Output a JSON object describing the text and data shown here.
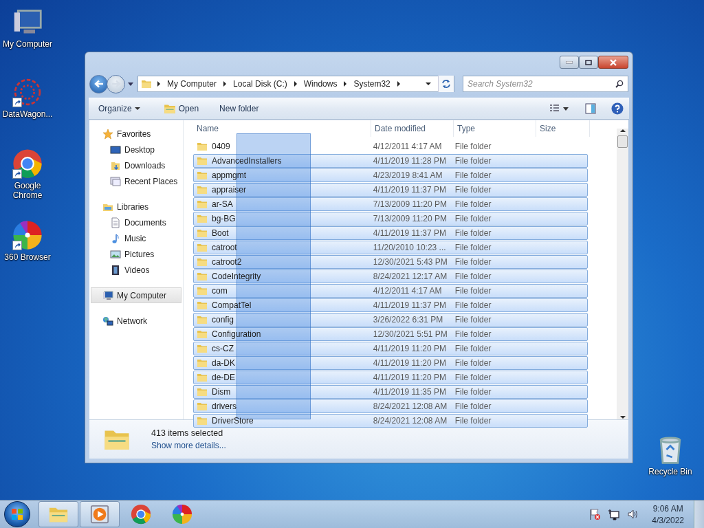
{
  "desktop_icons": [
    {
      "label": "My Computer",
      "kind": "computer"
    },
    {
      "label": "DataWagon...",
      "kind": "web"
    },
    {
      "label": "Google Chrome",
      "kind": "chrome"
    },
    {
      "label": "360 Browser",
      "kind": "pinwheel"
    },
    {
      "label": "Recycle Bin",
      "kind": "bin"
    }
  ],
  "window": {
    "address": {
      "crumbs": [
        "My Computer",
        "Local Disk (C:)",
        "Windows",
        "System32"
      ]
    },
    "search": {
      "placeholder": "Search System32"
    },
    "toolbar": {
      "organize": "Organize",
      "open": "Open",
      "new_folder": "New folder"
    },
    "nav": [
      {
        "label": "Favorites",
        "kind": "star",
        "selected": false,
        "children": [
          {
            "label": "Desktop",
            "kind": "desktop",
            "selected": false
          },
          {
            "label": "Downloads",
            "kind": "downloads",
            "selected": false
          },
          {
            "label": "Recent Places",
            "kind": "recent",
            "selected": false
          }
        ]
      },
      {
        "label": "Libraries",
        "kind": "library",
        "selected": false,
        "children": [
          {
            "label": "Documents",
            "kind": "document",
            "selected": false
          },
          {
            "label": "Music",
            "kind": "music",
            "selected": false
          },
          {
            "label": "Pictures",
            "kind": "picture",
            "selected": false
          },
          {
            "label": "Videos",
            "kind": "video",
            "selected": false
          }
        ]
      },
      {
        "label": "My Computer",
        "kind": "computer",
        "selected": true
      },
      {
        "label": "Network",
        "kind": "network",
        "selected": false
      }
    ],
    "columns": [
      "Name",
      "Date modified",
      "Type",
      "Size"
    ],
    "rows": [
      {
        "name": "0409",
        "date": "4/12/2011 4:17 AM",
        "type": "File folder",
        "selected": false
      },
      {
        "name": "AdvancedInstallers",
        "date": "4/11/2019 11:28 PM",
        "type": "File folder",
        "selected": true
      },
      {
        "name": "appmgmt",
        "date": "4/23/2019 8:41 AM",
        "type": "File folder",
        "selected": true
      },
      {
        "name": "appraiser",
        "date": "4/11/2019 11:37 PM",
        "type": "File folder",
        "selected": true
      },
      {
        "name": "ar-SA",
        "date": "7/13/2009 11:20 PM",
        "type": "File folder",
        "selected": true
      },
      {
        "name": "bg-BG",
        "date": "7/13/2009 11:20 PM",
        "type": "File folder",
        "selected": true
      },
      {
        "name": "Boot",
        "date": "4/11/2019 11:37 PM",
        "type": "File folder",
        "selected": true
      },
      {
        "name": "catroot",
        "date": "11/20/2010 10:23 ...",
        "type": "File folder",
        "selected": true
      },
      {
        "name": "catroot2",
        "date": "12/30/2021 5:43 PM",
        "type": "File folder",
        "selected": true
      },
      {
        "name": "CodeIntegrity",
        "date": "8/24/2021 12:17 AM",
        "type": "File folder",
        "selected": true
      },
      {
        "name": "com",
        "date": "4/12/2011 4:17 AM",
        "type": "File folder",
        "selected": true
      },
      {
        "name": "CompatTel",
        "date": "4/11/2019 11:37 PM",
        "type": "File folder",
        "selected": true
      },
      {
        "name": "config",
        "date": "3/26/2022 6:31 PM",
        "type": "File folder",
        "selected": true
      },
      {
        "name": "Configuration",
        "date": "12/30/2021 5:51 PM",
        "type": "File folder",
        "selected": true
      },
      {
        "name": "cs-CZ",
        "date": "4/11/2019 11:20 PM",
        "type": "File folder",
        "selected": true
      },
      {
        "name": "da-DK",
        "date": "4/11/2019 11:20 PM",
        "type": "File folder",
        "selected": true
      },
      {
        "name": "de-DE",
        "date": "4/11/2019 11:20 PM",
        "type": "File folder",
        "selected": true
      },
      {
        "name": "Dism",
        "date": "4/11/2019 11:35 PM",
        "type": "File folder",
        "selected": true
      },
      {
        "name": "drivers",
        "date": "8/24/2021 12:08 AM",
        "type": "File folder",
        "selected": true
      },
      {
        "name": "DriverStore",
        "date": "8/24/2021 12:08 AM",
        "type": "File folder",
        "selected": true
      }
    ],
    "details": {
      "summary": "413 items selected",
      "link": "Show more details..."
    }
  },
  "taskbar": {
    "items": [
      {
        "kind": "explorer",
        "running": true
      },
      {
        "kind": "media",
        "running": true
      },
      {
        "kind": "chrome",
        "running": false
      },
      {
        "kind": "pinwheel",
        "running": false
      }
    ],
    "clock": {
      "time": "9:06 AM",
      "date": "4/3/2022"
    }
  }
}
